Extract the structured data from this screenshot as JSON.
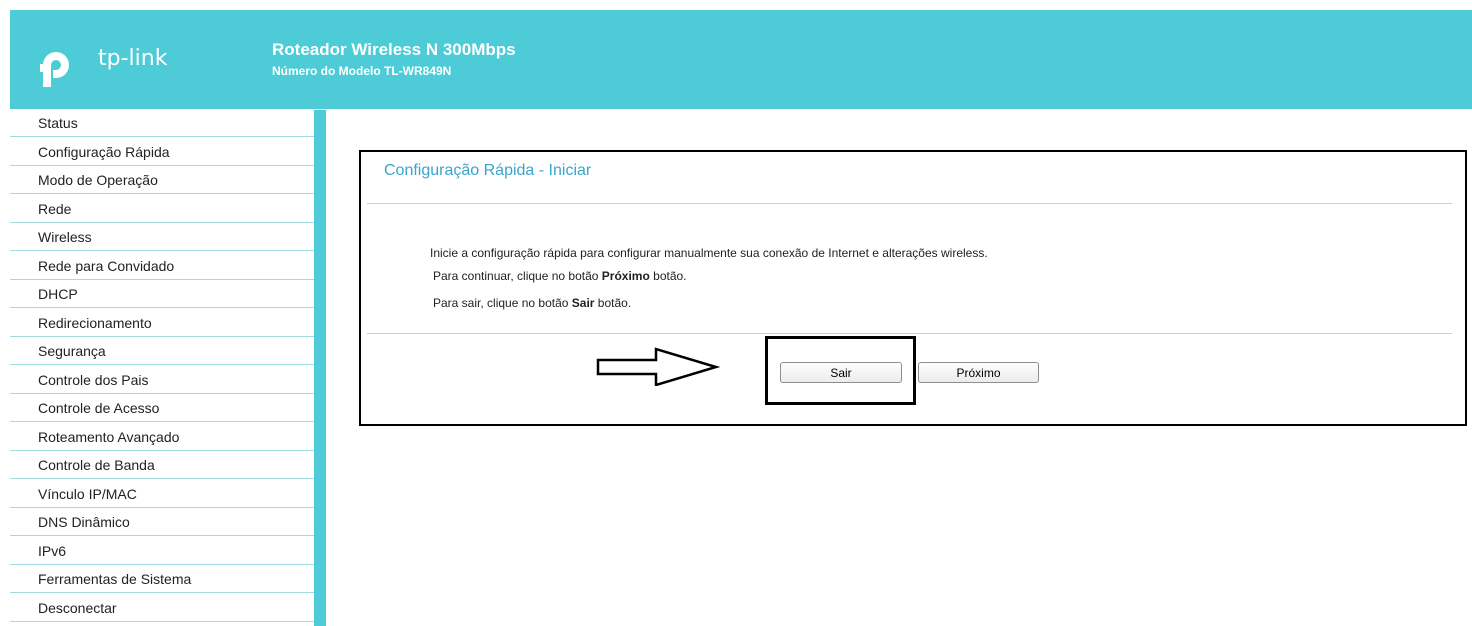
{
  "header": {
    "logo_text": "tp-link",
    "title": "Roteador Wireless N 300Mbps",
    "model": "Número do Modelo TL-WR849N",
    "color": "#4dcbd6"
  },
  "sidebar": {
    "items": [
      {
        "label": "Status"
      },
      {
        "label": "Configuração Rápida"
      },
      {
        "label": "Modo de Operação"
      },
      {
        "label": "Rede"
      },
      {
        "label": "Wireless"
      },
      {
        "label": "Rede para Convidado"
      },
      {
        "label": "DHCP"
      },
      {
        "label": "Redirecionamento"
      },
      {
        "label": "Segurança"
      },
      {
        "label": "Controle dos Pais"
      },
      {
        "label": "Controle de Acesso"
      },
      {
        "label": "Roteamento Avançado"
      },
      {
        "label": "Controle de Banda"
      },
      {
        "label": "Vínculo IP/MAC"
      },
      {
        "label": "DNS Dinâmico"
      },
      {
        "label": "IPv6"
      },
      {
        "label": "Ferramentas de Sistema"
      },
      {
        "label": "Desconectar"
      }
    ]
  },
  "main": {
    "title": "Configuração Rápida - Iniciar",
    "line1": "Inicie a configuração rápida para configurar manualmente sua conexão de Internet e alterações wireless.",
    "line2_prefix": "Para continuar, clique no botão ",
    "line2_bold": "Próximo",
    "line2_suffix": " botão.",
    "line3_prefix": "Para sair, clique no botão ",
    "line3_bold": "Sair",
    "line3_suffix": " botão.",
    "exit_button": "Sair",
    "next_button": "Próximo"
  }
}
